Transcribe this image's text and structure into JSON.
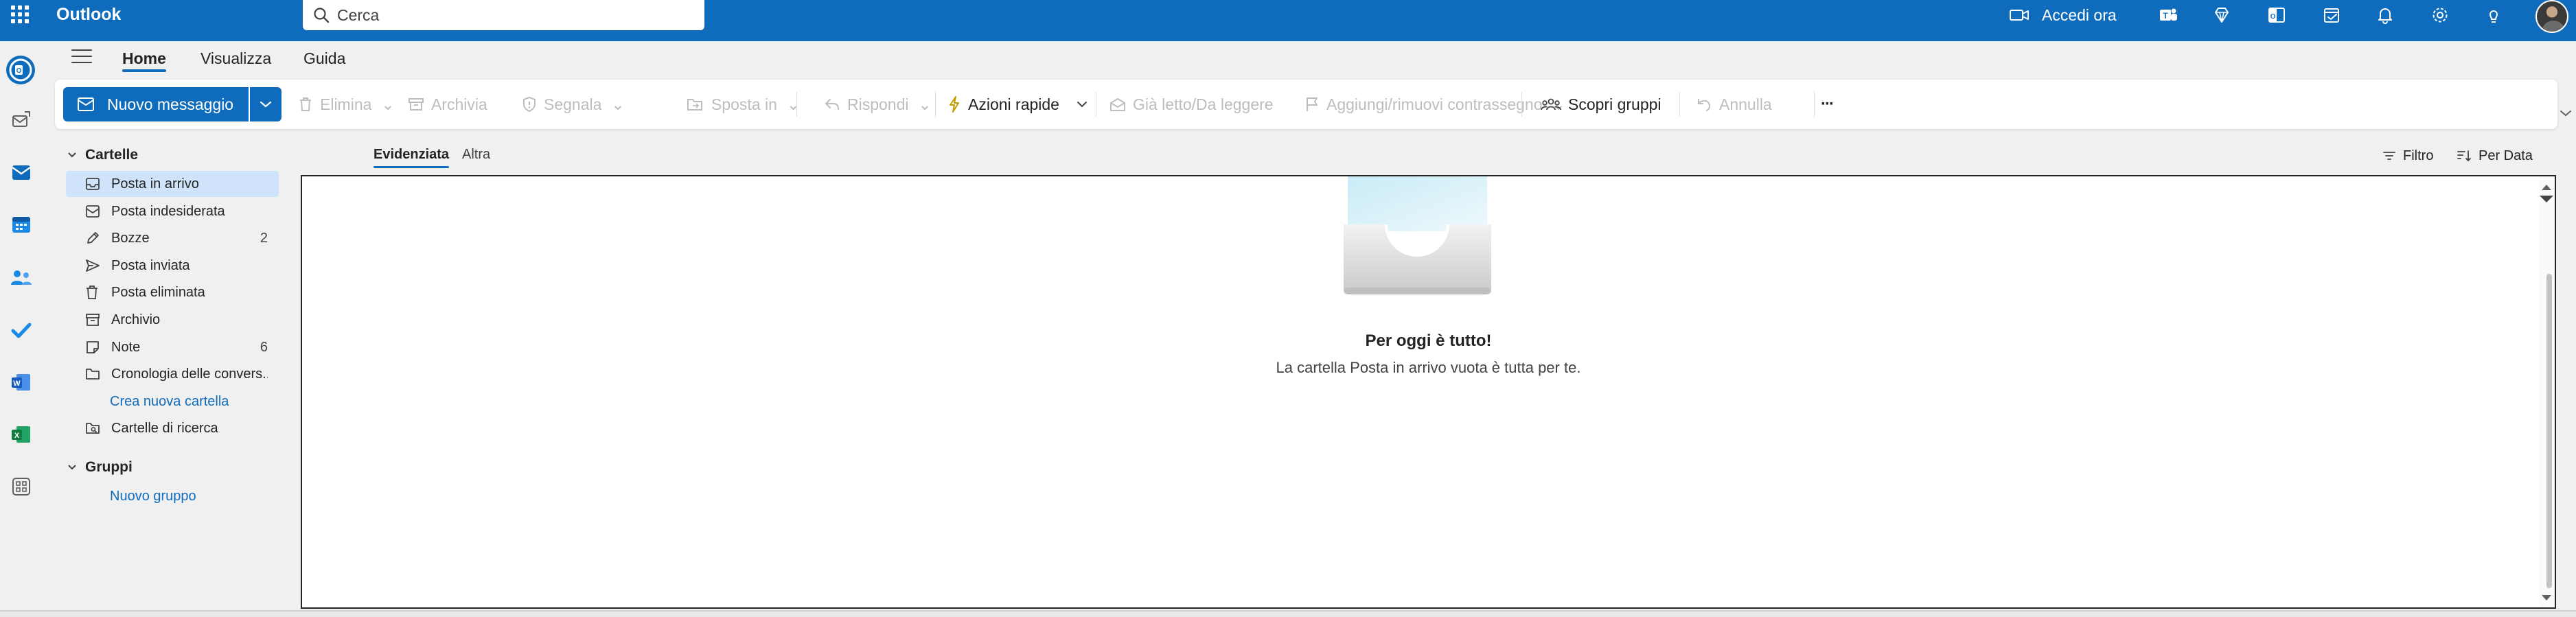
{
  "app": {
    "name": "Outlook"
  },
  "search": {
    "placeholder": "Cerca"
  },
  "topbar": {
    "signin_label": "Accedi ora"
  },
  "tabs": [
    {
      "label": "Home",
      "active": true
    },
    {
      "label": "Visualizza",
      "active": false
    },
    {
      "label": "Guida",
      "active": false
    }
  ],
  "ribbon": {
    "new_message": "Nuovo messaggio",
    "delete": "Elimina",
    "archive": "Archivia",
    "report": "Segnala",
    "move_to": "Sposta in",
    "reply": "Rispondi",
    "quick_steps": "Azioni rapide",
    "read_unread": "Già letto/Da leggere",
    "flag": "Aggiungi/rimuovi contrassegno",
    "discover_groups": "Scopri gruppi",
    "undo": "Annulla",
    "more": "···"
  },
  "folders": {
    "header": "Cartelle",
    "items": [
      {
        "label": "Posta in arrivo",
        "count": "",
        "selected": true
      },
      {
        "label": "Posta indesiderata",
        "count": ""
      },
      {
        "label": "Bozze",
        "count": "2"
      },
      {
        "label": "Posta inviata",
        "count": ""
      },
      {
        "label": "Posta eliminata",
        "count": ""
      },
      {
        "label": "Archivio",
        "count": ""
      },
      {
        "label": "Note",
        "count": "6"
      },
      {
        "label": "Cronologia delle convers...",
        "count": ""
      }
    ],
    "create_folder": "Crea nuova cartella",
    "search_folders": "Cartelle di ricerca"
  },
  "groups": {
    "header": "Gruppi",
    "new_group": "Nuovo gruppo"
  },
  "message_list": {
    "focused": "Evidenziata",
    "other": "Altra",
    "filter": "Filtro",
    "sort": "Per Data"
  },
  "empty_state": {
    "title": "Per oggi è tutto!",
    "subtitle": "La cartella Posta in arrivo vuota è tutta per te."
  },
  "colors": {
    "brand": "#0f6cbd",
    "selected": "#cfe4fa"
  }
}
